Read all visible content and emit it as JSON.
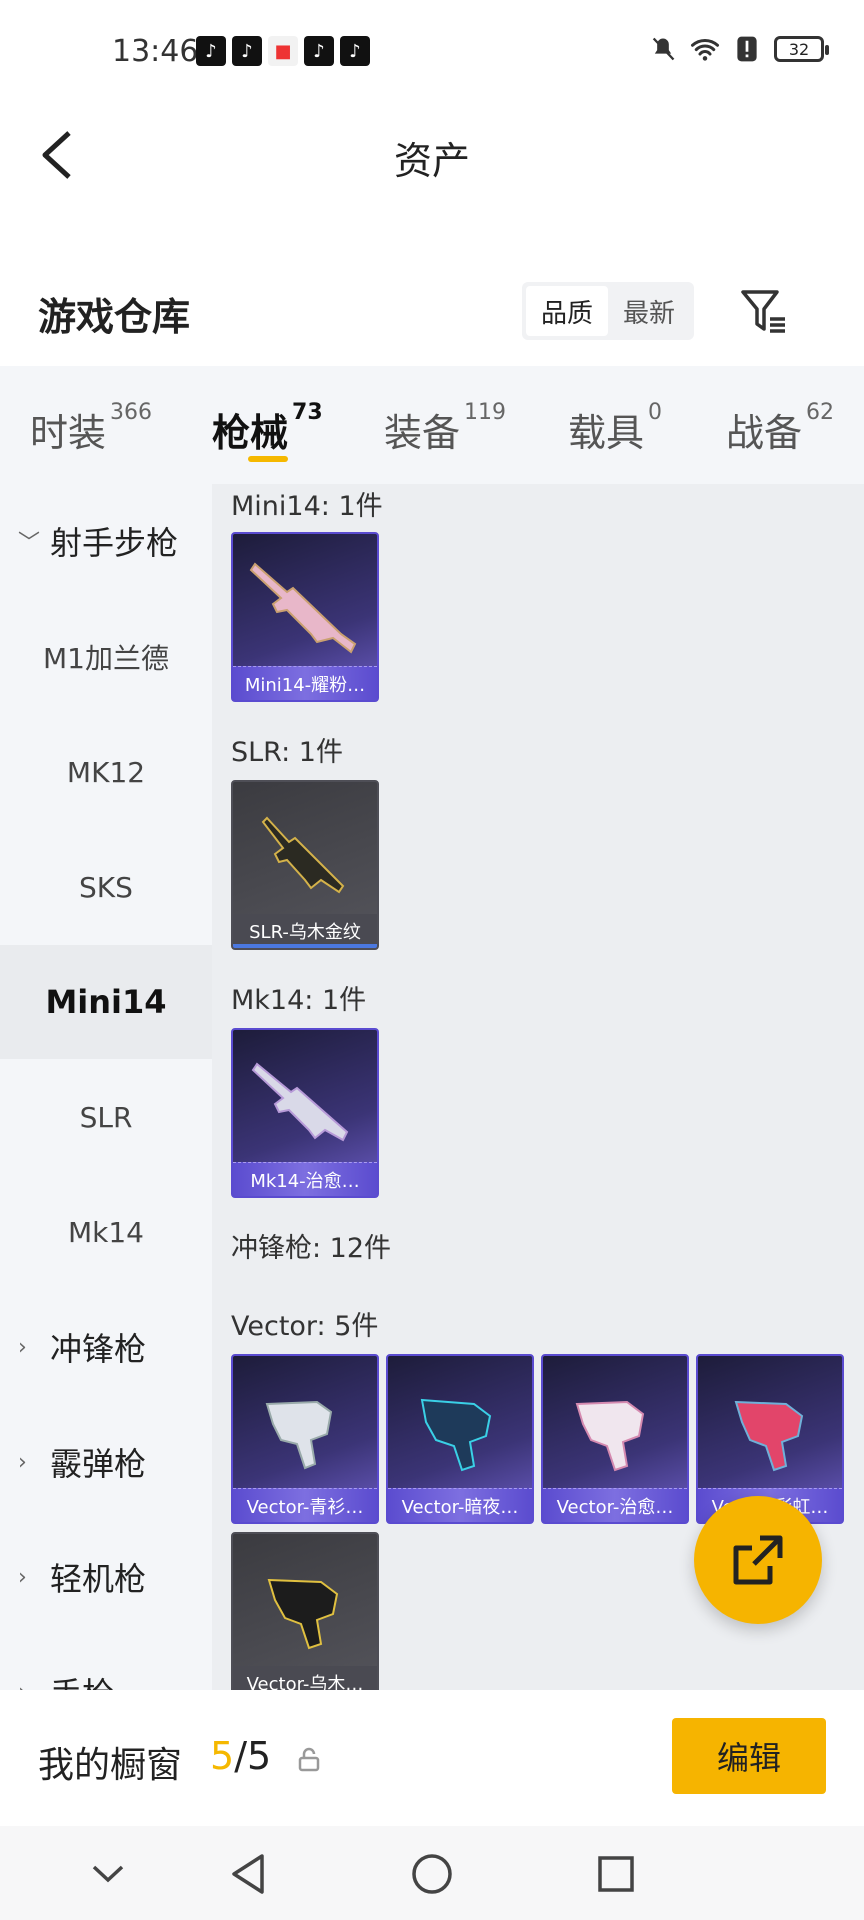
{
  "status_bar": {
    "time": "13:46",
    "battery": "32"
  },
  "header": {
    "title": "资产"
  },
  "section": {
    "title": "游戏仓库",
    "sort_options": [
      "品质",
      "最新"
    ]
  },
  "tabs": [
    {
      "label": "时装",
      "count": "366"
    },
    {
      "label": "枪械",
      "count": "73"
    },
    {
      "label": "装备",
      "count": "119"
    },
    {
      "label": "载具",
      "count": "0"
    },
    {
      "label": "战备",
      "count": "62"
    }
  ],
  "sidebar": [
    {
      "label": "射手步枪"
    },
    {
      "label": "M1加兰德"
    },
    {
      "label": "MK12"
    },
    {
      "label": "SKS"
    },
    {
      "label": "Mini14"
    },
    {
      "label": "SLR"
    },
    {
      "label": "Mk14"
    },
    {
      "label": "冲锋枪"
    },
    {
      "label": "霰弹枪"
    },
    {
      "label": "轻机枪"
    },
    {
      "label": "手枪"
    }
  ],
  "groups": [
    {
      "label": "Mini14: 1件"
    },
    {
      "label": "SLR: 1件"
    },
    {
      "label": "Mk14: 1件"
    },
    {
      "label": "冲锋枪: 12件"
    },
    {
      "label": "Vector: 5件"
    }
  ],
  "items": [
    {
      "name": "Mini14-耀粉…",
      "rarity": "purple"
    },
    {
      "name": "SLR-乌木金纹",
      "rarity": "gray"
    },
    {
      "name": "Mk14-治愈…",
      "rarity": "purple"
    },
    {
      "name": "Vector-青衫…",
      "rarity": "purple"
    },
    {
      "name": "Vector-暗夜…",
      "rarity": "purple"
    },
    {
      "name": "Vector-治愈…",
      "rarity": "purple"
    },
    {
      "name": "Vector-彩虹…",
      "rarity": "purple"
    },
    {
      "name": "Vector-乌木…",
      "rarity": "gray"
    }
  ],
  "bottom_bar": {
    "label": "我的橱窗",
    "count_current": "5",
    "count_total": "/5",
    "edit_label": "编辑"
  },
  "colors": {
    "accent": "#f6b400",
    "purple_card": "#5a4bd0",
    "gray_card": "#4e4e56"
  }
}
